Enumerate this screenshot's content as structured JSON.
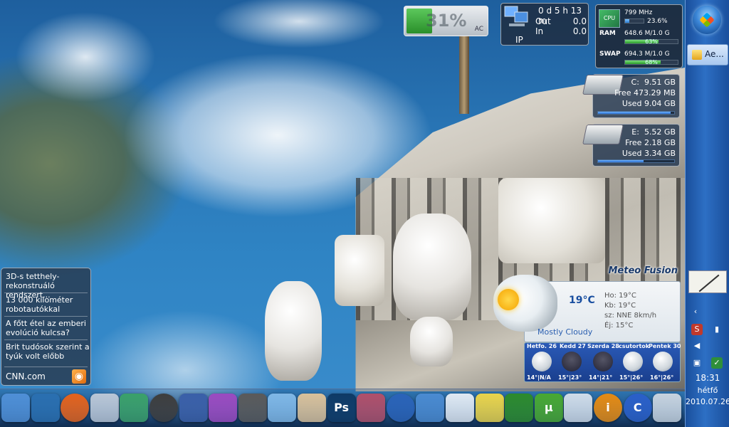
{
  "battery": {
    "percent_text": "31%",
    "percent": 31,
    "source": "AC"
  },
  "network": {
    "uptime": "0 d 5 h 13 m",
    "out_label": "Out",
    "out_value": "0.0",
    "in_label": "In",
    "in_value": "0.0",
    "ip_label": "IP"
  },
  "cpu_meter": {
    "cpu_label": "CPU",
    "cpu_freq": "799 MHz",
    "cpu_pct_text": "23.6%",
    "cpu_pct": 23.6,
    "ram_label": "RAM",
    "ram_value": "648.6 M/1.0 G",
    "ram_pct_text": "63%",
    "ram_pct": 63,
    "swap_label": "SWAP",
    "swap_value": "694.3 M/1.0 G",
    "swap_pct_text": "68%",
    "swap_pct": 68
  },
  "drives": [
    {
      "name": "C:",
      "total": "9.51 GB",
      "free_label": "Free",
      "free": "473.29 MB",
      "used_label": "Used",
      "used": "9.04 GB",
      "used_fraction": 0.95
    },
    {
      "name": "E:",
      "total": "5.52 GB",
      "free_label": "Free",
      "free": "2.18 GB",
      "used_label": "Used",
      "used": "3.34 GB",
      "used_fraction": 0.6
    }
  ],
  "news": {
    "items": [
      "3D-s tetthely-rekonstruáló rendszert...",
      "13 000 kilométer robotautókkal",
      "A főtt étel az emberi evolúció kulcsa?",
      "Brit tudósok szerint a tyúk volt előbb"
    ],
    "source": "CNN.com",
    "rss_icon": "rss-icon"
  },
  "weather": {
    "title": "Meteo Fusion",
    "temp": "19°C",
    "description": "Mostly Cloudy",
    "hi": "Ho: 19°C",
    "feels": "Kb: 19°C",
    "wind": "sz: NNE 8km/h",
    "night": "Éj: 15°C",
    "forecast": [
      {
        "day": "Hetfo. 26",
        "temps": "14°|N/A"
      },
      {
        "day": "Kedd 27",
        "temps": "15°|23°"
      },
      {
        "day": "Szerda 28",
        "temps": "14°|21°"
      },
      {
        "day": "csutortok",
        "temps": "15°|26°"
      },
      {
        "day": "Pentek 30",
        "temps": "16°|26°"
      }
    ]
  },
  "dock": {
    "items": [
      {
        "name": "computer",
        "glyph": "",
        "color": "#4f8fd6"
      },
      {
        "name": "network",
        "glyph": "",
        "color": "#2a6fb0"
      },
      {
        "name": "firefox",
        "glyph": "",
        "color": "#e4621c"
      },
      {
        "name": "documents",
        "glyph": "",
        "color": "#b9c6d6"
      },
      {
        "name": "downloads",
        "glyph": "",
        "color": "#3aa06a"
      },
      {
        "name": "media-player",
        "glyph": "",
        "color": "#3d3d3d"
      },
      {
        "name": "book",
        "glyph": "",
        "color": "#3a5fa8"
      },
      {
        "name": "onenote",
        "glyph": "",
        "color": "#9a4ac0"
      },
      {
        "name": "stapler",
        "glyph": "",
        "color": "#5a5a5a"
      },
      {
        "name": "glass-app",
        "glyph": "",
        "color": "#7fb7e6"
      },
      {
        "name": "paint",
        "glyph": "",
        "color": "#d8c09a"
      },
      {
        "name": "photoshop",
        "glyph": "Ps",
        "color": "#0e3a66"
      },
      {
        "name": "nebula",
        "glyph": "",
        "color": "#b04f6a"
      },
      {
        "name": "google-earth",
        "glyph": "",
        "color": "#2a63b8"
      },
      {
        "name": "search",
        "glyph": "",
        "color": "#4a8ad0"
      },
      {
        "name": "calculator",
        "glyph": "",
        "color": "#dfe8f2"
      },
      {
        "name": "sticky-notes",
        "glyph": "",
        "color": "#e9d34a"
      },
      {
        "name": "chart-app",
        "glyph": "",
        "color": "#2c8a2c"
      },
      {
        "name": "utorrent",
        "glyph": "µ",
        "color": "#48a832"
      },
      {
        "name": "keyboard",
        "glyph": "",
        "color": "#cfdbe8"
      },
      {
        "name": "info",
        "glyph": "i",
        "color": "#e58a12"
      },
      {
        "name": "ccleaner",
        "glyph": "C",
        "color": "#2a5fc8"
      },
      {
        "name": "recycle-bin",
        "glyph": "",
        "color": "#c6d2de"
      }
    ]
  },
  "taskbar": {
    "task_label": "Ae...",
    "time": "18:31",
    "day": "hétfő",
    "date": "2010.07.26.",
    "tray_icons": [
      "chevron-up-icon",
      "antivirus-icon",
      "signal-icon",
      "volume-icon",
      "usb-icon",
      "shield-icon"
    ]
  }
}
